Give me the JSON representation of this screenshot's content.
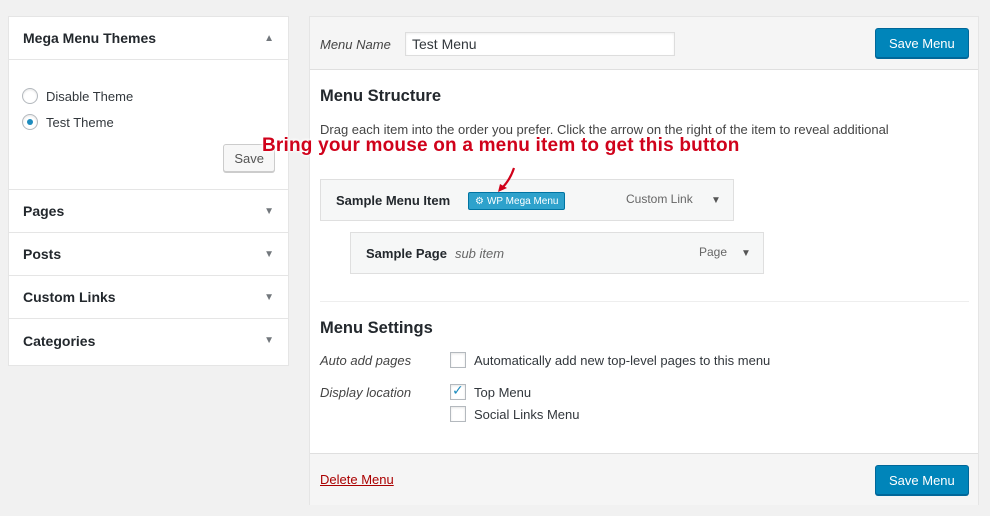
{
  "sidebar": {
    "themes_panel": {
      "title": "Mega Menu Themes",
      "options": [
        {
          "label": "Disable Theme",
          "checked": false
        },
        {
          "label": "Test Theme",
          "checked": true
        }
      ],
      "save_label": "Save"
    },
    "sections": [
      {
        "label": "Pages"
      },
      {
        "label": "Posts"
      },
      {
        "label": "Custom Links"
      },
      {
        "label": "Categories"
      }
    ]
  },
  "main": {
    "menu_name_label": "Menu Name",
    "menu_name_value": "Test Menu",
    "save_label": "Save Menu",
    "structure": {
      "title": "Menu Structure",
      "instructions": "Drag each item into the order you prefer. Click the arrow on the right of the item to reveal additional",
      "items": [
        {
          "title": "Sample Menu Item",
          "badge": "WP Mega Menu",
          "type": "Custom Link"
        },
        {
          "title": "Sample Page",
          "subtitle": "sub item",
          "type": "Page"
        }
      ]
    },
    "settings": {
      "title": "Menu Settings",
      "auto_add_label": "Auto add pages",
      "auto_add_option": {
        "label": "Automatically add new top-level pages to this menu",
        "checked": false
      },
      "display_location_label": "Display location",
      "locations": [
        {
          "label": "Top Menu",
          "checked": true
        },
        {
          "label": "Social Links Menu",
          "checked": false
        }
      ]
    },
    "delete_label": "Delete Menu"
  },
  "annotation": {
    "text": "Bring your mouse on a menu item to get this button",
    "color": "#d0021b"
  },
  "colors": {
    "primary": "#0085ba",
    "badge": "#2ea2cc",
    "delete": "#aa0000"
  }
}
